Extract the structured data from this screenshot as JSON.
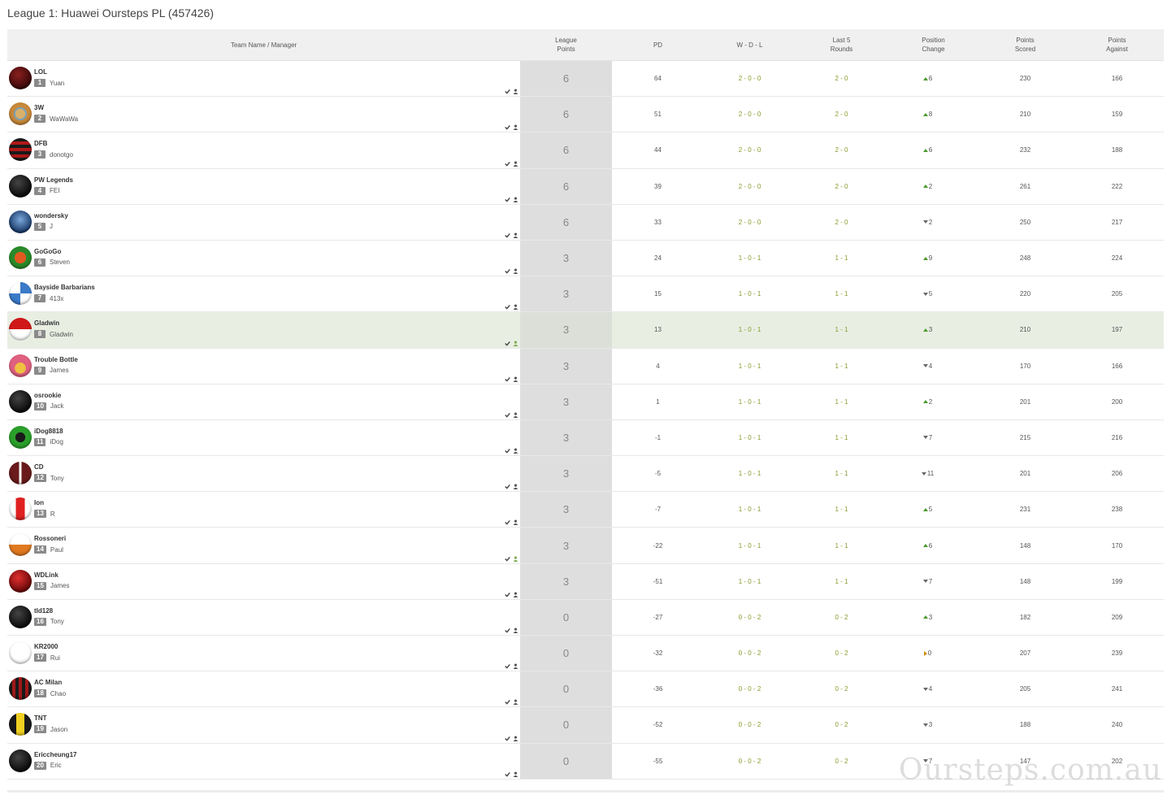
{
  "page": {
    "title": "League 1: Huawei Oursteps PL (457426)",
    "watermark": "Oursteps.com.au"
  },
  "columns": {
    "team": "Team Name / Manager",
    "league_points": "League\nPoints",
    "pd": "PD",
    "wdl": "W - D - L",
    "last5": "Last 5\nRounds",
    "position_change": "Position\nChange",
    "points_scored": "Points\nScored",
    "points_against": "Points\nAgainst"
  },
  "colors": {
    "header_bg": "#f0f0f0",
    "lp_bg": "#dedede",
    "highlight_row": "#e9eee3",
    "wdl_green": "#8a9a2a",
    "up_arrow": "#4a9a2a",
    "down_arrow": "#666666",
    "same_arrow": "#d08a00"
  },
  "rows": [
    {
      "team": "LOL",
      "rank": "1",
      "manager": "Yuan",
      "lp": "6",
      "pd": "64",
      "wdl": "2 - 0 - 0",
      "last5": "2 - 0",
      "dir": "up",
      "change": "6",
      "ps": "230",
      "pa": "166",
      "logo": "radial-gradient(circle at 40% 35%, #8a2020, #3a0808 70%)"
    },
    {
      "team": "3W",
      "rank": "2",
      "manager": "WaWaWa",
      "lp": "6",
      "pd": "51",
      "wdl": "2 - 0 - 0",
      "last5": "2 - 0",
      "dir": "up",
      "change": "8",
      "ps": "210",
      "pa": "159",
      "logo": "radial-gradient(circle, #d9b06a 30%, #7aa0b8 32%, #7aa0b8 40%, #c8893a 42%)"
    },
    {
      "team": "DFB",
      "rank": "3",
      "manager": "donotgo",
      "lp": "6",
      "pd": "44",
      "wdl": "2 - 0 - 0",
      "last5": "2 - 0",
      "dir": "up",
      "change": "6",
      "ps": "232",
      "pa": "188",
      "logo": "repeating-linear-gradient(180deg, #1a1a1a 0 4px, #b01818 4px 8px)"
    },
    {
      "team": "PW Legends",
      "rank": "4",
      "manager": "FEI",
      "lp": "6",
      "pd": "39",
      "wdl": "2 - 0 - 0",
      "last5": "2 - 0",
      "dir": "up",
      "change": "2",
      "ps": "261",
      "pa": "222",
      "logo": "radial-gradient(circle at 40% 35%, #444, #0a0a0a 70%)"
    },
    {
      "team": "wondersky",
      "rank": "5",
      "manager": "J",
      "lp": "6",
      "pd": "33",
      "wdl": "2 - 0 - 0",
      "last5": "2 - 0",
      "dir": "down",
      "change": "2",
      "ps": "250",
      "pa": "217",
      "logo": "radial-gradient(circle at 50% 40%, #7aa8d8, #1a3a6a 70%)"
    },
    {
      "team": "GoGoGo",
      "rank": "6",
      "manager": "Steven",
      "lp": "3",
      "pd": "24",
      "wdl": "1 - 0 - 1",
      "last5": "1 - 1",
      "dir": "up",
      "change": "9",
      "ps": "248",
      "pa": "224",
      "logo": "radial-gradient(circle, #e05a20 35%, #2a8a2a 37%)"
    },
    {
      "team": "Bayside Barbarians",
      "rank": "7",
      "manager": "413x",
      "lp": "3",
      "pd": "15",
      "wdl": "1 - 0 - 1",
      "last5": "1 - 1",
      "dir": "down",
      "change": "5",
      "ps": "220",
      "pa": "205",
      "logo": "conic-gradient(#3a7ac8 0 25%, #ffffff 25% 50%, #3a7ac8 50% 75%, #ffffff 75%)"
    },
    {
      "team": "Gladwin",
      "rank": "8",
      "manager": "Gladwin",
      "lp": "3",
      "pd": "13",
      "wdl": "1 - 0 - 1",
      "last5": "1 - 1",
      "dir": "up",
      "change": "3",
      "ps": "210",
      "pa": "197",
      "logo": "linear-gradient(180deg, #d01818 50%, #ffffff 50%)",
      "highlight": true
    },
    {
      "team": "Trouble Bottle",
      "rank": "9",
      "manager": "James",
      "lp": "3",
      "pd": "4",
      "wdl": "1 - 0 - 1",
      "last5": "1 - 1",
      "dir": "down",
      "change": "4",
      "ps": "170",
      "pa": "166",
      "logo": "radial-gradient(circle at 50% 60%, #f0c040 30%, #e06080 32%)"
    },
    {
      "team": "osrookie",
      "rank": "10",
      "manager": "Jack",
      "lp": "3",
      "pd": "1",
      "wdl": "1 - 0 - 1",
      "last5": "1 - 1",
      "dir": "up",
      "change": "2",
      "ps": "201",
      "pa": "200",
      "logo": "radial-gradient(circle at 40% 35%, #444, #0a0a0a 70%)"
    },
    {
      "team": "iDog8818",
      "rank": "11",
      "manager": "iDog",
      "lp": "3",
      "pd": "-1",
      "wdl": "1 - 0 - 1",
      "last5": "1 - 1",
      "dir": "down",
      "change": "7",
      "ps": "215",
      "pa": "216",
      "logo": "radial-gradient(circle, #1a1a1a 30%, #2aa02a 32%)"
    },
    {
      "team": "CD",
      "rank": "12",
      "manager": "Tony",
      "lp": "3",
      "pd": "-5",
      "wdl": "1 - 0 - 1",
      "last5": "1 - 1",
      "dir": "down",
      "change": "11",
      "ps": "201",
      "pa": "206",
      "logo": "linear-gradient(90deg, #6a1a1a 45%, #ffffff 45% 55%, #6a1a1a 55%)"
    },
    {
      "team": "Ion",
      "rank": "13",
      "manager": "R",
      "lp": "3",
      "pd": "-7",
      "wdl": "1 - 0 - 1",
      "last5": "1 - 1",
      "dir": "up",
      "change": "5",
      "ps": "231",
      "pa": "238",
      "logo": "linear-gradient(90deg, #ffffff 30%, #e02020 30% 70%, #ffffff 70%)"
    },
    {
      "team": "Rossoneri",
      "rank": "14",
      "manager": "Paul",
      "lp": "3",
      "pd": "-22",
      "wdl": "1 - 0 - 1",
      "last5": "1 - 1",
      "dir": "up",
      "change": "6",
      "ps": "148",
      "pa": "170",
      "logo": "linear-gradient(180deg, #ffffff 50%, #e07a20 50%)"
    },
    {
      "team": "WDLink",
      "rank": "15",
      "manager": "James",
      "lp": "3",
      "pd": "-51",
      "wdl": "1 - 0 - 1",
      "last5": "1 - 1",
      "dir": "down",
      "change": "7",
      "ps": "148",
      "pa": "199",
      "logo": "radial-gradient(circle at 40% 35%, #e03030, #6a0808 70%)"
    },
    {
      "team": "tld128",
      "rank": "16",
      "manager": "Tony",
      "lp": "0",
      "pd": "-27",
      "wdl": "0 - 0 - 2",
      "last5": "0 - 2",
      "dir": "up",
      "change": "3",
      "ps": "182",
      "pa": "209",
      "logo": "radial-gradient(circle at 40% 35%, #444, #0a0a0a 70%)"
    },
    {
      "team": "KR2000",
      "rank": "17",
      "manager": "Rui",
      "lp": "0",
      "pd": "-32",
      "wdl": "0 - 0 - 2",
      "last5": "0 - 2",
      "dir": "same",
      "change": "0",
      "ps": "207",
      "pa": "239",
      "logo": "linear-gradient(180deg, #d01818 50%, repeating-linear-gradient(90deg, #d01818 0 3px, #ffffff 3px 6px) 50%)"
    },
    {
      "team": "AC Milan",
      "rank": "18",
      "manager": "Chao",
      "lp": "0",
      "pd": "-36",
      "wdl": "0 - 0 - 2",
      "last5": "0 - 2",
      "dir": "down",
      "change": "4",
      "ps": "205",
      "pa": "241",
      "logo": "repeating-linear-gradient(90deg, #1a1a1a 0 4px, #a01818 4px 8px)"
    },
    {
      "team": "TNT",
      "rank": "19",
      "manager": "Jason",
      "lp": "0",
      "pd": "-52",
      "wdl": "0 - 0 - 2",
      "last5": "0 - 2",
      "dir": "down",
      "change": "3",
      "ps": "188",
      "pa": "240",
      "logo": "linear-gradient(90deg, #1a1a1a 33%, #f0d020 33% 67%, #1a1a1a 67%)"
    },
    {
      "team": "Ericcheung17",
      "rank": "20",
      "manager": "Eric",
      "lp": "0",
      "pd": "-55",
      "wdl": "0 - 0 - 2",
      "last5": "0 - 2",
      "dir": "down",
      "change": "7",
      "ps": "147",
      "pa": "202",
      "logo": "radial-gradient(circle at 40% 35%, #444, #0a0a0a 70%)"
    }
  ]
}
